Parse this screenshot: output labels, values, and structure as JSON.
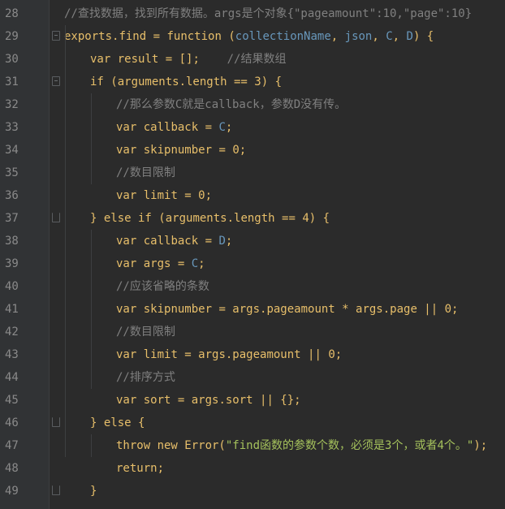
{
  "editor": {
    "lines": [
      {
        "num": "28",
        "indent": 0,
        "fold": "",
        "tokens": [
          {
            "t": "//查找数据，找到所有数据。args是个对象{\"pageamount\":10,\"page\":10}",
            "c": "cmt"
          }
        ]
      },
      {
        "num": "29",
        "indent": 0,
        "fold": "open",
        "tokens": [
          {
            "t": "exports",
            "c": "text"
          },
          {
            "t": ".",
            "c": "text"
          },
          {
            "t": "find",
            "c": "fn"
          },
          {
            "t": " = ",
            "c": "text"
          },
          {
            "t": "function",
            "c": "fn"
          },
          {
            "t": " (",
            "c": "text"
          },
          {
            "t": "collectionName",
            "c": "param"
          },
          {
            "t": ", ",
            "c": "text"
          },
          {
            "t": "json",
            "c": "param"
          },
          {
            "t": ", ",
            "c": "text"
          },
          {
            "t": "C",
            "c": "param"
          },
          {
            "t": ", ",
            "c": "text"
          },
          {
            "t": "D",
            "c": "param"
          },
          {
            "t": ") {",
            "c": "text"
          }
        ]
      },
      {
        "num": "30",
        "indent": 1,
        "fold": "",
        "tokens": [
          {
            "t": "var",
            "c": "fn"
          },
          {
            "t": " result = [];    ",
            "c": "text"
          },
          {
            "t": "//结果数组",
            "c": "cmt"
          }
        ]
      },
      {
        "num": "31",
        "indent": 1,
        "fold": "open",
        "tokens": [
          {
            "t": "if",
            "c": "fn"
          },
          {
            "t": " (arguments.length == ",
            "c": "text"
          },
          {
            "t": "3",
            "c": "text"
          },
          {
            "t": ") {",
            "c": "text"
          }
        ]
      },
      {
        "num": "32",
        "indent": 2,
        "fold": "",
        "tokens": [
          {
            "t": "//那么参数C就是callback，参数D没有传。",
            "c": "cmt"
          }
        ]
      },
      {
        "num": "33",
        "indent": 2,
        "fold": "",
        "tokens": [
          {
            "t": "var",
            "c": "fn"
          },
          {
            "t": " callback = ",
            "c": "text"
          },
          {
            "t": "C",
            "c": "param"
          },
          {
            "t": ";",
            "c": "text"
          }
        ]
      },
      {
        "num": "34",
        "indent": 2,
        "fold": "",
        "tokens": [
          {
            "t": "var",
            "c": "fn"
          },
          {
            "t": " skipnumber = ",
            "c": "text"
          },
          {
            "t": "0",
            "c": "text"
          },
          {
            "t": ";",
            "c": "text"
          }
        ]
      },
      {
        "num": "35",
        "indent": 2,
        "fold": "",
        "tokens": [
          {
            "t": "//数目限制",
            "c": "cmt"
          }
        ]
      },
      {
        "num": "36",
        "indent": 2,
        "fold": "",
        "tokens": [
          {
            "t": "var",
            "c": "fn"
          },
          {
            "t": " limit = ",
            "c": "text"
          },
          {
            "t": "0",
            "c": "text"
          },
          {
            "t": ";",
            "c": "text"
          }
        ]
      },
      {
        "num": "37",
        "indent": 1,
        "fold": "end",
        "tokens": [
          {
            "t": "} ",
            "c": "text"
          },
          {
            "t": "else if",
            "c": "fn"
          },
          {
            "t": " (arguments.length == ",
            "c": "text"
          },
          {
            "t": "4",
            "c": "text"
          },
          {
            "t": ") {",
            "c": "text"
          }
        ]
      },
      {
        "num": "38",
        "indent": 2,
        "fold": "",
        "tokens": [
          {
            "t": "var",
            "c": "fn"
          },
          {
            "t": " callback = ",
            "c": "text"
          },
          {
            "t": "D",
            "c": "param"
          },
          {
            "t": ";",
            "c": "text"
          }
        ]
      },
      {
        "num": "39",
        "indent": 2,
        "fold": "",
        "tokens": [
          {
            "t": "var",
            "c": "fn"
          },
          {
            "t": " args = ",
            "c": "text"
          },
          {
            "t": "C",
            "c": "param"
          },
          {
            "t": ";",
            "c": "text"
          }
        ]
      },
      {
        "num": "40",
        "indent": 2,
        "fold": "",
        "tokens": [
          {
            "t": "//应该省略的条数",
            "c": "cmt"
          }
        ]
      },
      {
        "num": "41",
        "indent": 2,
        "fold": "",
        "tokens": [
          {
            "t": "var",
            "c": "fn"
          },
          {
            "t": " skipnumber = args.pageamount * args.page || ",
            "c": "text"
          },
          {
            "t": "0",
            "c": "text"
          },
          {
            "t": ";",
            "c": "text"
          }
        ]
      },
      {
        "num": "42",
        "indent": 2,
        "fold": "",
        "tokens": [
          {
            "t": "//数目限制",
            "c": "cmt"
          }
        ]
      },
      {
        "num": "43",
        "indent": 2,
        "fold": "",
        "tokens": [
          {
            "t": "var",
            "c": "fn"
          },
          {
            "t": " limit = args.pageamount || ",
            "c": "text"
          },
          {
            "t": "0",
            "c": "text"
          },
          {
            "t": ";",
            "c": "text"
          }
        ]
      },
      {
        "num": "44",
        "indent": 2,
        "fold": "",
        "tokens": [
          {
            "t": "//排序方式",
            "c": "cmt"
          }
        ]
      },
      {
        "num": "45",
        "indent": 2,
        "fold": "",
        "tokens": [
          {
            "t": "var",
            "c": "fn"
          },
          {
            "t": " sort = args.sort || {};",
            "c": "text"
          }
        ]
      },
      {
        "num": "46",
        "indent": 1,
        "fold": "end",
        "tokens": [
          {
            "t": "} ",
            "c": "text"
          },
          {
            "t": "else",
            "c": "fn"
          },
          {
            "t": " {",
            "c": "text"
          }
        ]
      },
      {
        "num": "47",
        "indent": 2,
        "fold": "",
        "tokens": [
          {
            "t": "throw new",
            "c": "fn"
          },
          {
            "t": " Error(",
            "c": "text"
          },
          {
            "t": "\"find函数的参数个数，必须是3个，或者4个。\"",
            "c": "str"
          },
          {
            "t": ");",
            "c": "text"
          }
        ]
      },
      {
        "num": "48",
        "indent": 2,
        "fold": "",
        "tokens": [
          {
            "t": "return",
            "c": "fn"
          },
          {
            "t": ";",
            "c": "text"
          }
        ]
      },
      {
        "num": "49",
        "indent": 1,
        "fold": "end",
        "tokens": [
          {
            "t": "}",
            "c": "text"
          }
        ]
      }
    ]
  }
}
